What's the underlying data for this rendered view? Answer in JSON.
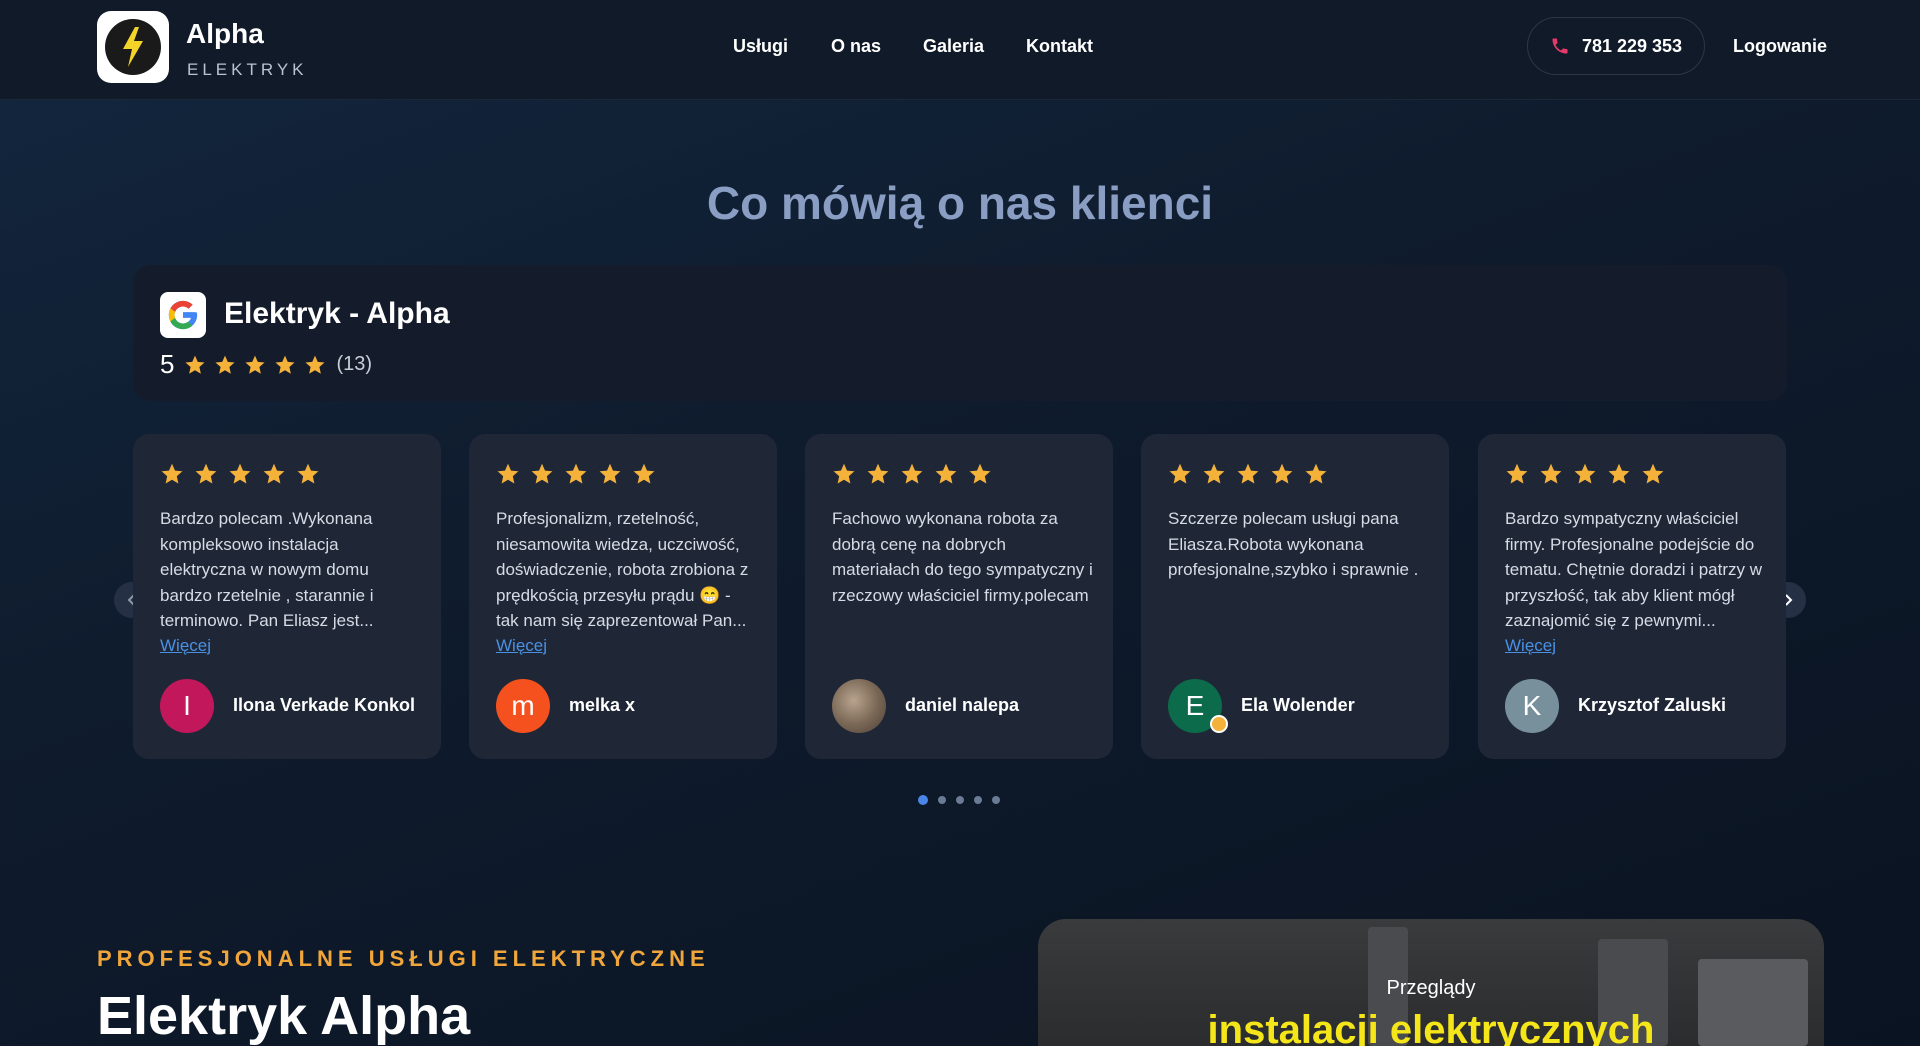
{
  "header": {
    "brand_name": "Alpha",
    "brand_sub": "ELEKTRYK",
    "nav": [
      "Usługi",
      "O nas",
      "Galeria",
      "Kontakt"
    ],
    "phone": "781 229 353",
    "login": "Logowanie"
  },
  "section": {
    "title": "Co mówią o nas klienci"
  },
  "google": {
    "business_name": "Elektryk - Alpha",
    "score": "5",
    "stars": 5,
    "count": "(13)"
  },
  "reviews": [
    {
      "stars": 5,
      "text": "Bardzo polecam .Wykonana kompleksowo instalacja elektryczna w nowym domu bardzo rzetelnie , starannie i terminowo. Pan Eliasz jest...",
      "more": "Więcej",
      "avatar_letter": "I",
      "author": "Ilona Verkade Konkol"
    },
    {
      "stars": 5,
      "text": "Profesjonalizm, rzetelność, niesamowita wiedza, uczciwość, doświadczenie, robota zrobiona z prędkością przesyłu prądu 😁 - tak nam się zaprezentował Pan...",
      "more": "Więcej",
      "avatar_letter": "m",
      "author": "melka x"
    },
    {
      "stars": 5,
      "text": "Fachowo wykonana robota za dobrą cenę na dobrych materiałach do tego sympatyczny i rzeczowy właściciel firmy.polecam",
      "more": "",
      "avatar_letter": "",
      "author": "daniel nalepa"
    },
    {
      "stars": 5,
      "text": "Szczerze polecam usługi pana Eliasza.Robota wykonana profesjonalne,szybko i sprawnie .",
      "more": "",
      "avatar_letter": "E",
      "author": "Ela Wolender"
    },
    {
      "stars": 5,
      "text": "Bardzo sympatyczny właściciel firmy. Profesjonalne podejście do tematu. Chętnie doradzi i patrzy w przyszłość, tak aby klient mógł zaznajomić się z pewnymi...",
      "more": "Więcej",
      "avatar_letter": "K",
      "author": "Krzysztof Zaluski"
    }
  ],
  "carousel": {
    "pages": 5,
    "active": 0
  },
  "hero": {
    "eyebrow": "PROFESJONALNE USŁUGI ELEKTRYCZNE",
    "title": "Elektryk Alpha",
    "image_caption_small": "Przeglądy",
    "image_caption_large": "instalacji elektrycznych"
  },
  "colors": {
    "star": "#f4b23b",
    "accent_orange": "#f0a63a",
    "link": "#4a90e2",
    "title_muted": "#8a9dc2",
    "avatar_1": "#c2185b",
    "avatar_2": "#f4511e",
    "avatar_4": "#0b6b4a",
    "avatar_5": "#78909c"
  }
}
